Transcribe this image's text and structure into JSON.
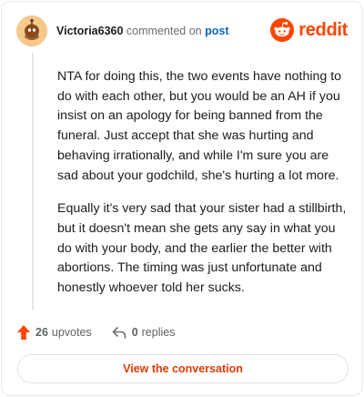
{
  "header": {
    "username": "Victoria6360",
    "action_text": "commented on",
    "post_link": "post",
    "brand": "reddit"
  },
  "comment": {
    "paragraphs": [
      "NTA for doing this, the two events have nothing to do with each other, but you would be an AH if you insist on an apology for being banned from the funeral. Just accept that she was hurting and behaving irrationally, and while I'm sure you are sad about your godchild, she's hurting a lot more.",
      "Equally it's very sad that your sister had a stillbirth, but it doesn't mean she gets any say in what you do with your body, and the earlier the better with abortions. The timing was just unfortunate and honestly whoever told her sucks."
    ]
  },
  "stats": {
    "upvotes_count": "26",
    "upvotes_label": "upvotes",
    "replies_count": "0",
    "replies_label": "replies"
  },
  "cta": {
    "label": "View the conversation"
  },
  "icons": {
    "avatar": "avatar-icon",
    "brand": "reddit-logo-icon",
    "upvote": "upvote-arrow-icon",
    "reply": "reply-arrow-icon"
  },
  "colors": {
    "brand_orange": "#ff4500",
    "link_blue": "#0a66c2",
    "cta_text": "#e03a00",
    "avatar_bg": "#f5c98c"
  }
}
